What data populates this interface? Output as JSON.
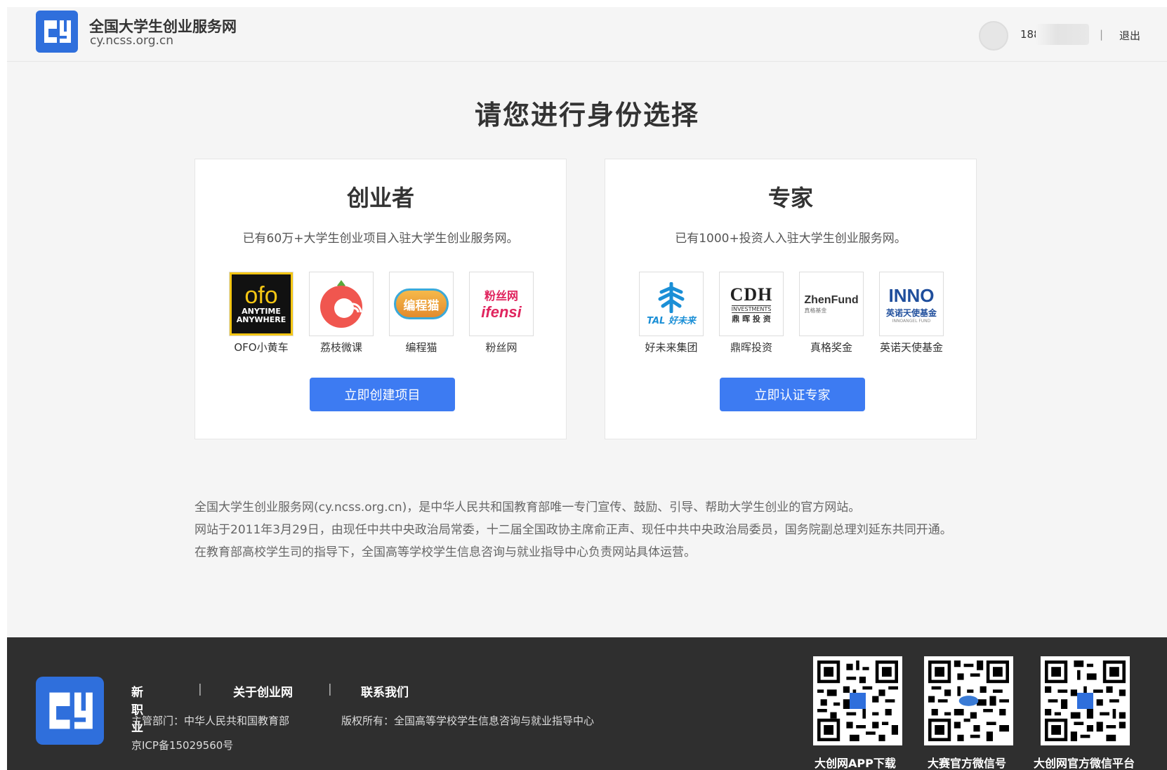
{
  "header": {
    "brand_name": "全国大学生创业服务网",
    "brand_url": "cy.ncss.org.cn",
    "phone": "188",
    "separator": "|",
    "logout_label": "退出",
    "accent": "#2f6fdc"
  },
  "main": {
    "heading": "请您进行身份选择",
    "cards": [
      {
        "title": "创业者",
        "desc": "已有60万+大学生创业项目入驻大学生创业服务网。",
        "logos": [
          {
            "label": "OFO小黄车",
            "mark": "ofo",
            "sub1": "ANYTIME",
            "sub2": "ANYWHERE"
          },
          {
            "label": "荔枝微课",
            "mark": ""
          },
          {
            "label": "编程猫",
            "mark": "编程猫"
          },
          {
            "label": "粉丝网",
            "mark": "粉丝网",
            "sub1": "ifensi"
          }
        ],
        "cta": "立即创建项目"
      },
      {
        "title": "专家",
        "desc": "已有1000+投资人入驻大学生创业服务网。",
        "logos": [
          {
            "label": "好未来集团",
            "mark": "TAL 好未来"
          },
          {
            "label": "鼎晖投资",
            "mark": "CDH",
            "sub1": "INVESTMENTS",
            "sub2": "鼎 晖 投 资"
          },
          {
            "label": "真格奖金",
            "mark": "ZhenFund",
            "sub1": "真格基金"
          },
          {
            "label": "英诺天使基金",
            "mark": "INNO",
            "sub1": "英诺天使基金",
            "sub2": "INNOANGEL FUND"
          }
        ],
        "cta": "立即认证专家"
      }
    ],
    "cta_color": "#3d7bf2"
  },
  "intro": [
    "全国大学生创业服务网(cy.ncss.org.cn)，是中华人民共和国教育部唯一专门宣传、鼓励、引导、帮助大学生创业的官方网站。",
    "网站于2011年3月29日，由现任中共中央政治局常委，十二届全国政协主席俞正声、现任中共中央政治局委员，国务院副总理刘延东共同开通。",
    "在教育部高校学生司的指导下，全国高等学校学生信息咨询与就业指导中心负责网站具体运营。"
  ],
  "footer": {
    "links": [
      "新职业",
      "关于创业网",
      "联系我们"
    ],
    "link_separator": "|",
    "dept": "主管部门：中华人民共和国教育部",
    "copyright": "版权所有：全国高等学校学生信息咨询与就业指导中心",
    "icp": "京ICP备15029560号",
    "qrcodes": [
      {
        "label": "大创网APP下载"
      },
      {
        "label": "大赛官方微信号"
      },
      {
        "label": "大创网官方微信平台"
      }
    ]
  }
}
